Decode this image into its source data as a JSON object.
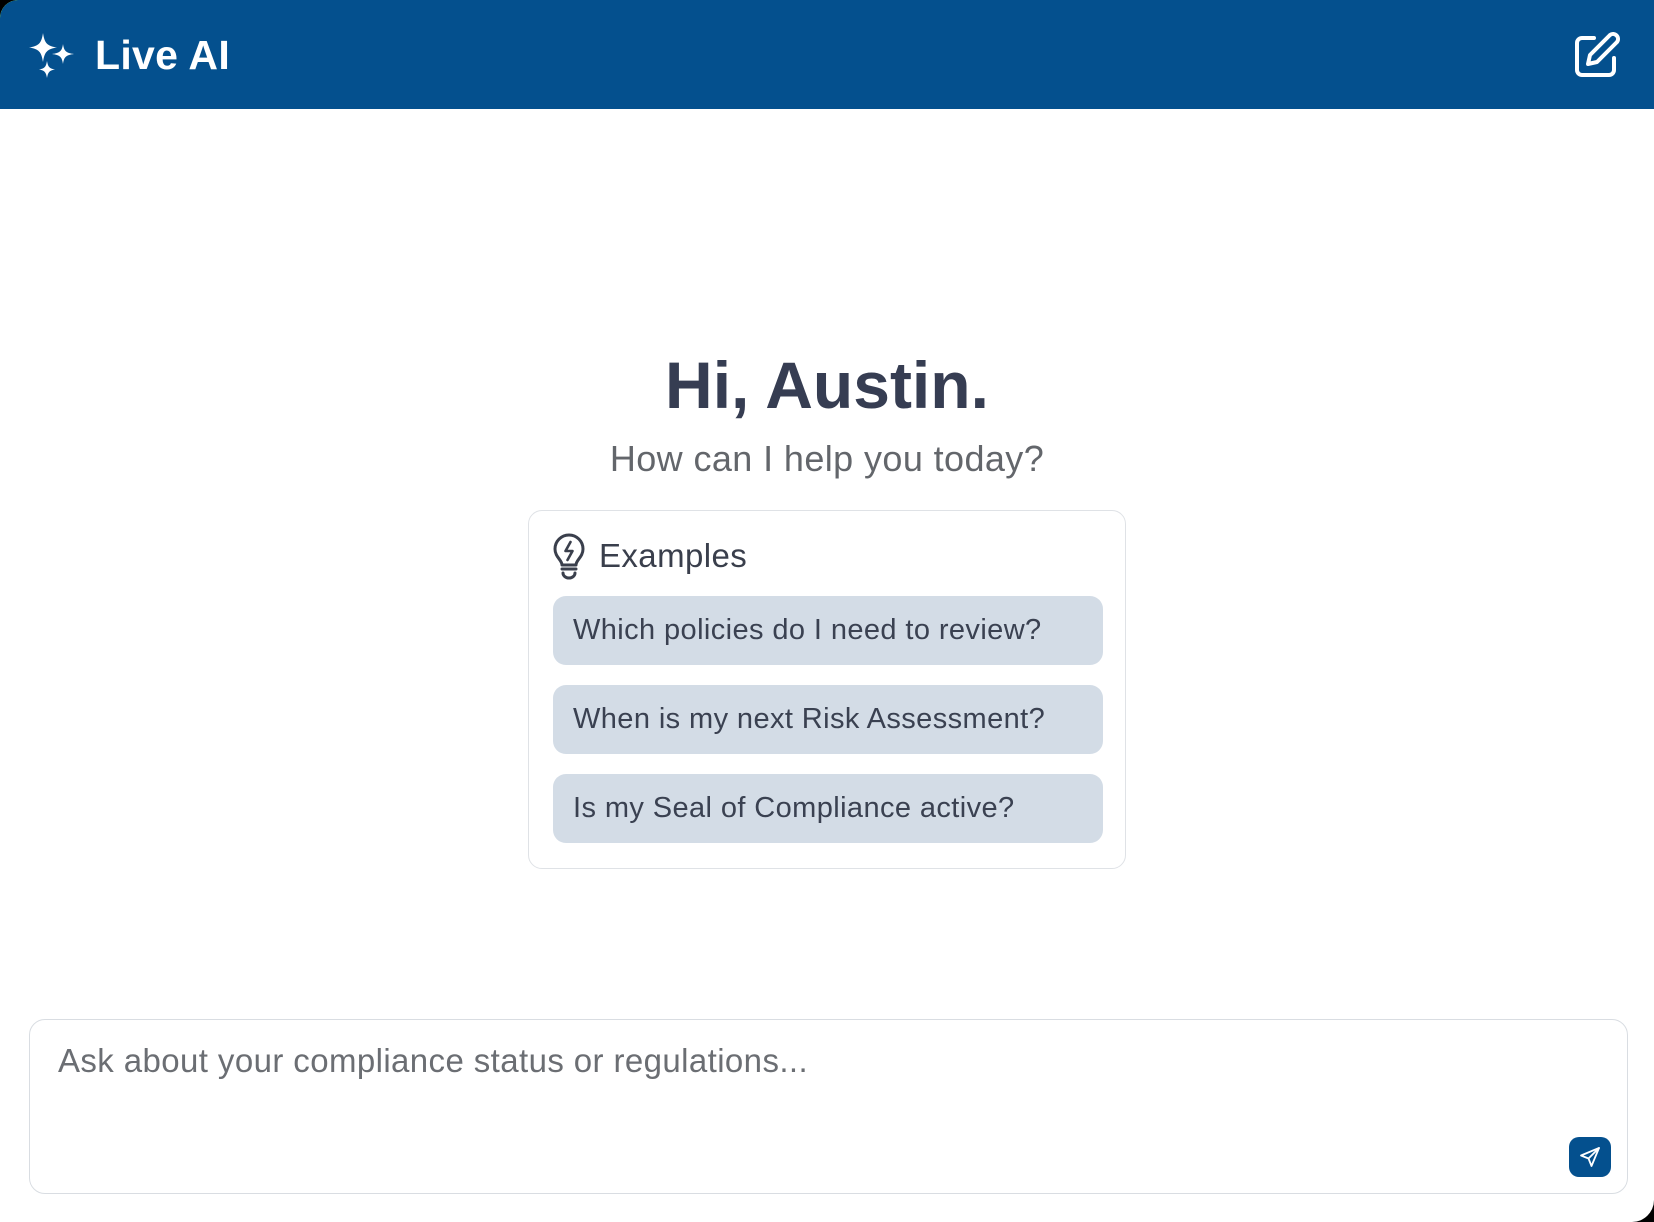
{
  "header": {
    "title": "Live AI",
    "brand_icon": "sparkles-icon",
    "new_chat_icon": "edit-square-icon",
    "background_color": "#04508e"
  },
  "welcome": {
    "greeting": "Hi, Austin.",
    "subtitle": "How can I help you today?"
  },
  "examples": {
    "title": "Examples",
    "icon": "lightbulb-icon",
    "items": [
      {
        "label": "Which policies do I need to review?"
      },
      {
        "label": "When is my next Risk Assessment?"
      },
      {
        "label": "Is my Seal of Compliance active?"
      }
    ],
    "chip_color": "#d3dce6"
  },
  "composer": {
    "placeholder": "Ask about your compliance status or regulations...",
    "value": "",
    "send_icon": "send-icon",
    "send_color": "#04508e"
  }
}
